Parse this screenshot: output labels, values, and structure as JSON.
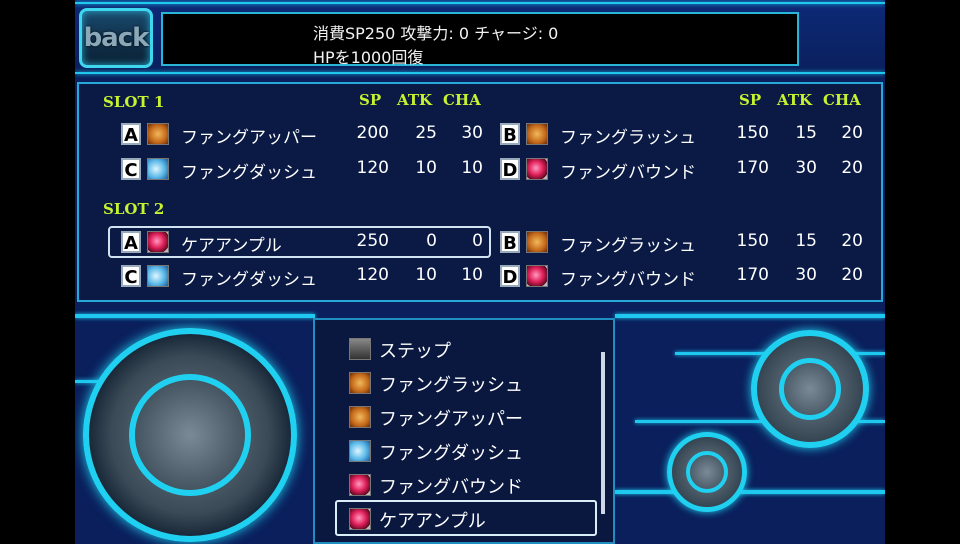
{
  "header": {
    "back_label": "back",
    "desc_line1": "消費SP250 攻撃力: 0 チャージ: 0",
    "desc_line2": "HPを1000回復"
  },
  "slots": {
    "col_sp": "SP",
    "col_atk": "ATK",
    "col_cha": "CHA",
    "slot1": {
      "label": "SLOT 1",
      "left": [
        {
          "key": "A",
          "icon": "fist-icon",
          "name": "ファングアッパー",
          "sp": "200",
          "atk": "25",
          "cha": "30"
        },
        {
          "key": "C",
          "icon": "dash-icon",
          "name": "ファングダッシュ",
          "sp": "120",
          "atk": "10",
          "cha": "10"
        }
      ],
      "right": [
        {
          "key": "B",
          "icon": "fist-icon",
          "name": "ファングラッシュ",
          "sp": "150",
          "atk": "15",
          "cha": "20"
        },
        {
          "key": "D",
          "icon": "orb-icon",
          "name": "ファングバウンド",
          "sp": "170",
          "atk": "30",
          "cha": "20"
        }
      ]
    },
    "slot2": {
      "label": "SLOT 2",
      "left": [
        {
          "key": "A",
          "icon": "orb-icon",
          "name": "ケアアンプル",
          "sp": "250",
          "atk": "0",
          "cha": "0"
        },
        {
          "key": "C",
          "icon": "dash-icon",
          "name": "ファングダッシュ",
          "sp": "120",
          "atk": "10",
          "cha": "10"
        }
      ],
      "right": [
        {
          "key": "B",
          "icon": "fist-icon",
          "name": "ファングラッシュ",
          "sp": "150",
          "atk": "15",
          "cha": "20"
        },
        {
          "key": "D",
          "icon": "orb-icon",
          "name": "ファングバウンド",
          "sp": "170",
          "atk": "30",
          "cha": "20"
        }
      ]
    }
  },
  "skill_menu": {
    "items": [
      {
        "icon": "step-icon",
        "label": "ステップ"
      },
      {
        "icon": "fist-icon",
        "label": "ファングラッシュ"
      },
      {
        "icon": "fist-icon",
        "label": "ファングアッパー"
      },
      {
        "icon": "dash-icon",
        "label": "ファングダッシュ"
      },
      {
        "icon": "orb-icon",
        "label": "ファングバウンド"
      },
      {
        "icon": "orb-icon",
        "label": "ケアアンプル"
      }
    ],
    "selected_index": 5
  },
  "colors": {
    "accent": "#1ec8ef",
    "slot_header": "#c6f230",
    "panel_bg": "#0a1f5c"
  }
}
